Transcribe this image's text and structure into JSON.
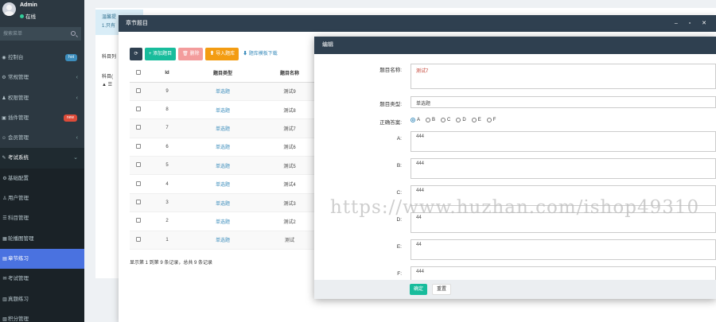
{
  "sidebar": {
    "user": {
      "name": "Admin",
      "status": "在线"
    },
    "search_placeholder": "搜索菜单",
    "items": [
      {
        "icon": "dashboard-icon",
        "glyph": "◉",
        "label": "控制台",
        "badge": "hot",
        "badge_color": "#3c8dbc",
        "chevron": ""
      },
      {
        "icon": "cogs-icon",
        "glyph": "⚙",
        "label": "常规管理",
        "badge": "",
        "chevron": "‹"
      },
      {
        "icon": "group-icon",
        "glyph": "♟",
        "label": "权限管理",
        "badge": "",
        "chevron": "‹"
      },
      {
        "icon": "plugin-icon",
        "glyph": "▣",
        "label": "插件管理",
        "badge": "new",
        "badge_color": "#dd4b39",
        "chevron": ""
      },
      {
        "icon": "user-circle-icon",
        "glyph": "☺",
        "label": "会员管理",
        "badge": "",
        "chevron": "‹"
      },
      {
        "icon": "exam-icon",
        "glyph": "✎",
        "label": "考试系统",
        "badge": "",
        "chevron": "⌄"
      },
      {
        "icon": "gear-icon",
        "glyph": "⚙",
        "label": "基础配置",
        "badge": "",
        "chevron": ""
      },
      {
        "icon": "user-icon",
        "glyph": "♙",
        "label": "用户管理",
        "badge": "",
        "chevron": ""
      },
      {
        "icon": "list-icon",
        "glyph": "☰",
        "label": "科目管理",
        "badge": "",
        "chevron": ""
      },
      {
        "icon": "image-icon",
        "glyph": "▦",
        "label": "轮播图管理",
        "badge": "",
        "chevron": ""
      },
      {
        "icon": "book-icon",
        "glyph": "▤",
        "label": "章节练习",
        "badge": "",
        "chevron": ""
      },
      {
        "icon": "file-icon",
        "glyph": "✉",
        "label": "考试管理",
        "badge": "",
        "chevron": ""
      },
      {
        "icon": "list-alt-icon",
        "glyph": "▥",
        "label": "真题练习",
        "badge": "",
        "chevron": ""
      },
      {
        "icon": "table-icon",
        "glyph": "▧",
        "label": "积分管理",
        "badge": "",
        "chevron": ""
      }
    ]
  },
  "background": {
    "alert_line1": "温馨提",
    "alert_line2": "1.只有",
    "tab_label": "科目列",
    "tree_line1": "科目(",
    "tree_line2": "▲ ☰"
  },
  "layer1": {
    "title": "章节题目",
    "window_buttons": "– ▫ ✕",
    "toolbar": {
      "refresh": "⟳",
      "add": "+ 添加题目",
      "delete": "🗑 删除",
      "import": "⬆ 导入题库",
      "download": "⬇ 题库模板下载"
    },
    "columns": [
      "",
      "Id",
      "题目类型",
      "题目名称"
    ],
    "rows": [
      {
        "id": "9",
        "type": "单选题",
        "name": "测试9"
      },
      {
        "id": "8",
        "type": "单选题",
        "name": "测试8"
      },
      {
        "id": "7",
        "type": "单选题",
        "name": "测试7"
      },
      {
        "id": "6",
        "type": "单选题",
        "name": "测试6"
      },
      {
        "id": "5",
        "type": "单选题",
        "name": "测试5"
      },
      {
        "id": "4",
        "type": "单选题",
        "name": "测试4"
      },
      {
        "id": "3",
        "type": "单选题",
        "name": "测试3"
      },
      {
        "id": "2",
        "type": "单选题",
        "name": "测试2"
      },
      {
        "id": "1",
        "type": "单选题",
        "name": "测试"
      }
    ],
    "pager_text": "显示第 1 到第 9 条记录，总共 9 条记录"
  },
  "layer2": {
    "title": "编辑",
    "fields": {
      "name_label": "题目名称:",
      "name_value": "测试7",
      "type_label": "题目类型:",
      "type_value": "单选题",
      "answer_label": "正确答案:",
      "answers": [
        "A",
        "B",
        "C",
        "D",
        "E",
        "F"
      ],
      "answer_selected": "A",
      "options": [
        {
          "label": "A:",
          "value": "444"
        },
        {
          "label": "B:",
          "value": "444"
        },
        {
          "label": "C:",
          "value": "444"
        },
        {
          "label": "D:",
          "value": "44"
        },
        {
          "label": "E:",
          "value": "44"
        },
        {
          "label": "F:",
          "value": "444"
        }
      ]
    },
    "buttons": {
      "ok": "确定",
      "reset": "重置"
    }
  },
  "watermark": "https://www.huzhan.com/ishop49310"
}
